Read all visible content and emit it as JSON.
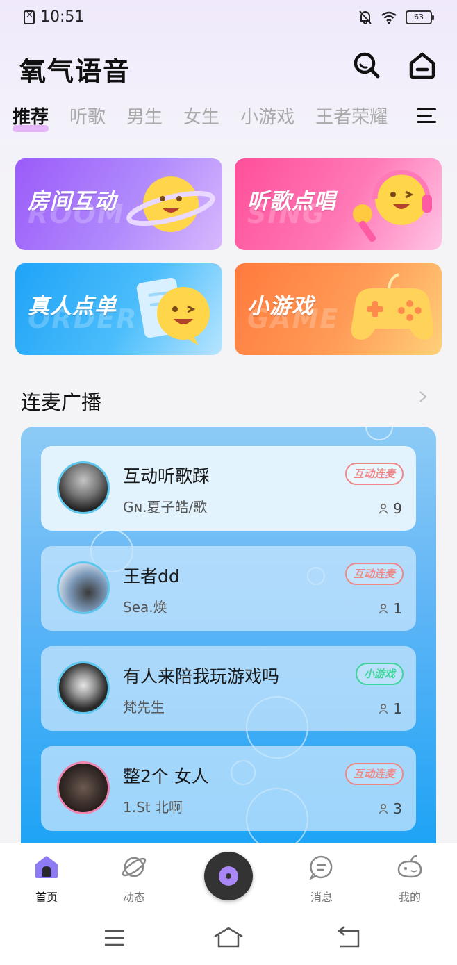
{
  "status_bar": {
    "time": "10:51",
    "battery": "63"
  },
  "header": {
    "title": "氧气语音"
  },
  "tabs": [
    {
      "label": "推荐",
      "active": true
    },
    {
      "label": "听歌"
    },
    {
      "label": "男生"
    },
    {
      "label": "女生"
    },
    {
      "label": "小游戏"
    },
    {
      "label": "王者荣耀"
    }
  ],
  "feature_cards": [
    {
      "title": "房间互动",
      "sub": "ROOM"
    },
    {
      "title": "听歌点唱",
      "sub": "SING"
    },
    {
      "title": "真人点单",
      "sub": "ORDER"
    },
    {
      "title": "小游戏",
      "sub": "GAME"
    }
  ],
  "section": {
    "title": "连麦广播"
  },
  "rooms": [
    {
      "name": "互动听歌踩",
      "host": "Gɴ.夏子皓/歌",
      "tag": "互动连麦",
      "count": "9"
    },
    {
      "name": "王者dd",
      "host": "Sea.焕",
      "tag": "互动连麦",
      "count": "1"
    },
    {
      "name": "有人来陪我玩游戏吗",
      "host": "梵先生",
      "tag": "小游戏",
      "count": "1"
    },
    {
      "name": "整2个 女人",
      "host": "1.St 北啊",
      "tag": "互动连麦",
      "count": "3"
    }
  ],
  "bottom_nav": {
    "home": "首页",
    "feed": "动态",
    "messages": "消息",
    "profile": "我的"
  },
  "colors": {
    "accent": "#a987f6",
    "room_tag": "#f08787",
    "game_tag": "#3ed59b"
  }
}
